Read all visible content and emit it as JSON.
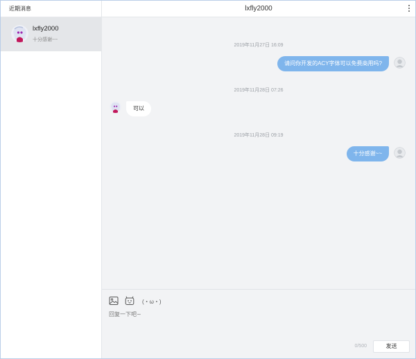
{
  "sidebar": {
    "header": "近期消息",
    "conversations": [
      {
        "name": "lxfly2000",
        "preview": "十分感谢~~",
        "selected": true
      }
    ]
  },
  "chat": {
    "title": "lxfly2000",
    "messages": [
      {
        "timestamp": "2019年11月27日 16:09",
        "direction": "outgoing",
        "text": "请问你开发的ACY字体可以免费商用吗?"
      },
      {
        "timestamp": "2019年11月28日 07:26",
        "direction": "incoming",
        "text": "可以"
      },
      {
        "timestamp": "2019年11月28日 09:19",
        "direction": "outgoing",
        "text": "十分感谢~~"
      }
    ]
  },
  "composer": {
    "kaomoji": "(・ω・)",
    "placeholder": "回复一下吧~",
    "value": "",
    "counter": "0/500",
    "send_label": "发送"
  },
  "colors": {
    "outgoing_bubble": "#7fb5ec",
    "incoming_bubble": "#ffffff",
    "panel_bg": "#f2f3f5",
    "selected_item_bg": "#e4e6e9"
  },
  "icons": {
    "more": "more-vertical-icon",
    "image": "image-icon",
    "emoji": "emoji-icon"
  }
}
